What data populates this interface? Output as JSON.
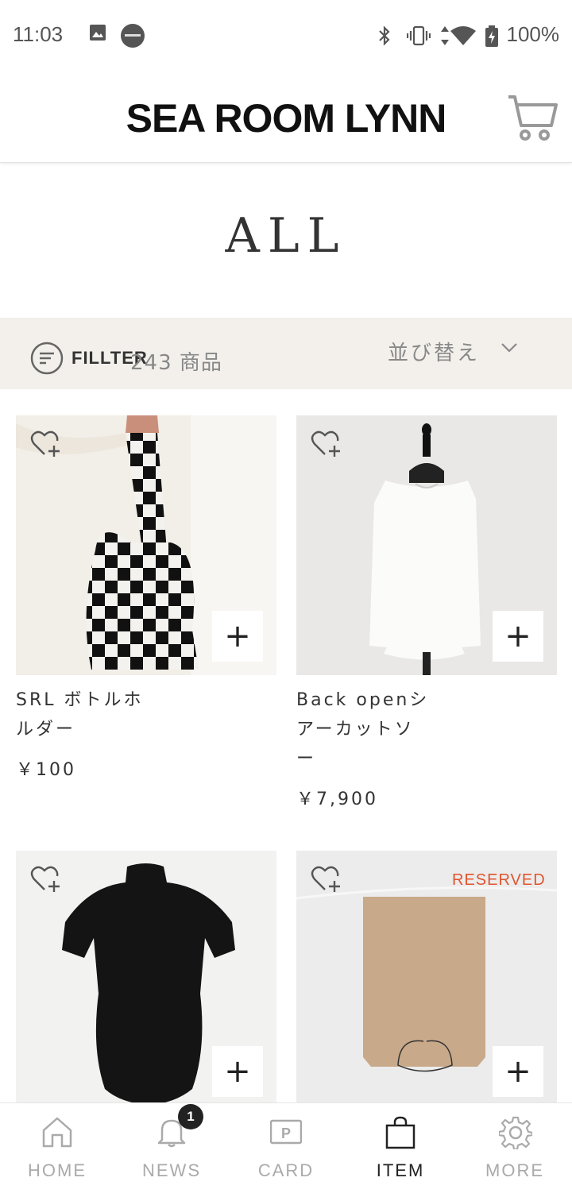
{
  "status_bar": {
    "time": "11:03",
    "battery": "100%"
  },
  "header": {
    "brand": "SEA ROOM LYNN"
  },
  "page": {
    "title": "ALL"
  },
  "filter_bar": {
    "filter_label": "FILLTER",
    "item_count": "243 商品",
    "sort_label": "並び替え"
  },
  "products": [
    {
      "name": "SRL ボトルホルダー",
      "name_lines": [
        "SRL ボトルホ",
        "ルダー"
      ],
      "price": "￥100",
      "reserved": ""
    },
    {
      "name": "Back openシアーカットソー",
      "name_lines": [
        "Back openシ",
        "アーカットソ",
        "ー"
      ],
      "price": "￥7,900",
      "reserved": ""
    },
    {
      "name": "",
      "name_lines": [],
      "price": "",
      "reserved": ""
    },
    {
      "name": "",
      "name_lines": [],
      "price": "",
      "reserved": "RESERVED"
    }
  ],
  "bottom_nav": {
    "items": [
      {
        "label": "HOME",
        "icon": "home-icon",
        "active": false
      },
      {
        "label": "NEWS",
        "icon": "bell-icon",
        "active": false,
        "badge": "1"
      },
      {
        "label": "CARD",
        "icon": "point-card-icon",
        "active": false
      },
      {
        "label": "ITEM",
        "icon": "shopping-bag-icon",
        "active": true
      },
      {
        "label": "MORE",
        "icon": "gear-icon",
        "active": false
      }
    ]
  },
  "colors": {
    "filter_bar_bg": "#f3f0ec",
    "accent_reserved": "#e0552f",
    "nav_active": "#222222",
    "nav_inactive": "#aaaaaa"
  }
}
